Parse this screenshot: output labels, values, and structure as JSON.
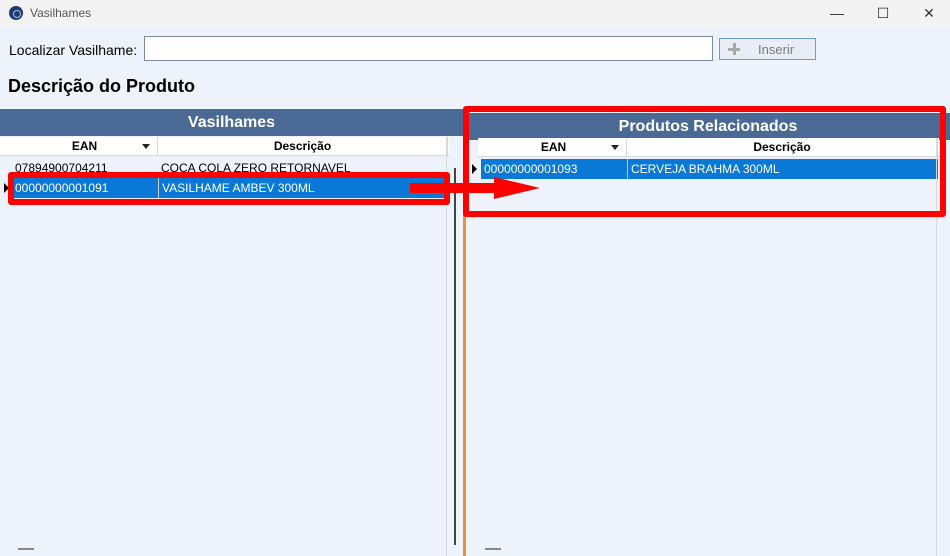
{
  "window": {
    "title": "Vasilhames",
    "minimize": "—",
    "maximize": "☐",
    "close": "✕"
  },
  "search": {
    "label": "Localizar Vasilhame:",
    "value": "",
    "placeholder": "",
    "insert_label": "Inserir"
  },
  "section": {
    "title": "Descrição do Produto"
  },
  "left_grid": {
    "header": "Vasilhames",
    "columns": [
      "EAN",
      "Descrição"
    ],
    "rows": [
      {
        "ean": "07894900704211",
        "descricao": "COCA COLA ZERO RETORNAVEL"
      },
      {
        "ean": "00000000001091",
        "descricao": "VASILHAME AMBEV 300ML"
      }
    ],
    "selected_row": 1
  },
  "right_grid": {
    "header": "Produtos Relacionados",
    "columns": [
      "EAN",
      "Descrição"
    ],
    "rows": [
      {
        "ean": "00000000001093",
        "descricao": "CERVEJA BRAHMA 300ML"
      }
    ],
    "selected_row": 0
  },
  "colors": {
    "header_bg": "#4a6995",
    "selection": "#0a78d7",
    "annotation": "#ff0000",
    "splitter": "#e89339"
  }
}
